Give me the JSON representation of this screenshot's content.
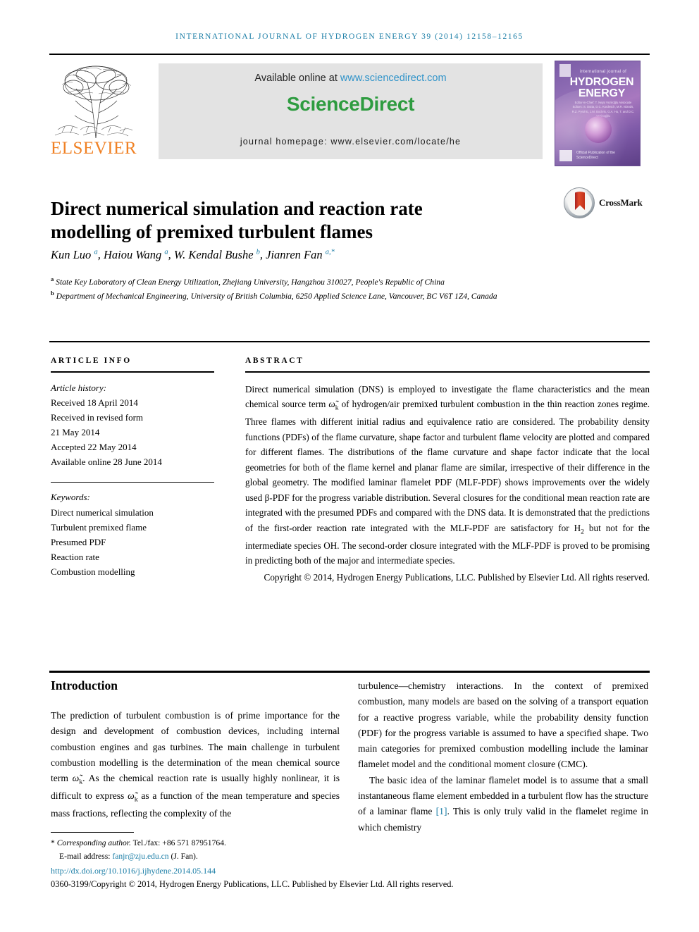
{
  "running_head": "INTERNATIONAL JOURNAL OF HYDROGEN ENERGY 39 (2014) 12158–12165",
  "masthead": {
    "publisher_name": "ELSEVIER",
    "available_prefix": "Available online at ",
    "available_url": "www.sciencedirect.com",
    "sciencedirect_logo": "ScienceDirect",
    "journal_homepage": "journal homepage: www.elsevier.com/locate/he",
    "cover": {
      "kicker": "international journal of",
      "title_line1": "HYDROGEN",
      "title_line2": "ENERGY",
      "editors": "Editor-in-Chief: T. Nejat Veziroğlu\nAssociate Editors: S. Dutta, D.C. Kordesch, M.R. Islands, R.Z. Pyrohic, J.M. Bockris, G.A. Hu, T. and D.C. Vezirogğlu",
      "bottom_note": "Official Publication of the\nScienceDirect"
    }
  },
  "article": {
    "title": "Direct numerical simulation and reaction rate modelling of premixed turbulent flames",
    "crossmark_label": "CrossMark",
    "authors_html": "Kun Luo <sup>a</sup>, Haiou Wang <sup>a</sup>, W. Kendal Bushe <sup>b</sup>, Jianren Fan <sup>a,*</sup>",
    "affiliations": [
      "State Key Laboratory of Clean Energy Utilization, Zhejiang University, Hangzhou 310027, People's Republic of China",
      "Department of Mechanical Engineering, University of British Columbia, 6250 Applied Science Lane, Vancouver, BC V6T 1Z4, Canada"
    ],
    "affiliation_marks": [
      "a",
      "b"
    ]
  },
  "article_info": {
    "heading": "ARTICLE INFO",
    "history_label": "Article history:",
    "history": [
      "Received 18 April 2014",
      "Received in revised form",
      "21 May 2014",
      "Accepted 22 May 2014",
      "Available online 28 June 2014"
    ],
    "keywords_label": "Keywords:",
    "keywords": [
      "Direct numerical simulation",
      "Turbulent premixed flame",
      "Presumed PDF",
      "Reaction rate",
      "Combustion modelling"
    ]
  },
  "abstract": {
    "heading": "ABSTRACT",
    "part1": "Direct numerical simulation (DNS) is employed to investigate the flame characteristics and the mean chemical source term ",
    "symbol": "ω̃",
    "symbol_sub": "k",
    "part2": " of hydrogen/air premixed turbulent combustion in the thin reaction zones regime. Three flames with different initial radius and equivalence ratio are considered. The probability density functions (PDFs) of the flame curvature, shape factor and turbulent flame velocity are plotted and compared for different flames. The distributions of the flame curvature and shape factor indicate that the local geometries for both of the flame kernel and planar flame are similar, irrespective of their difference in the global geometry. The modified laminar flamelet PDF (MLF-PDF) shows improvements over the widely used β-PDF for the progress variable distribution. Several closures for the conditional mean reaction rate are integrated with the presumed PDFs and compared with the DNS data. It is demonstrated that the predictions of the first-order reaction rate integrated with the MLF-PDF are satisfactory for H",
    "h2_sub": "2",
    "part3": " but not for the intermediate species OH. The second-order closure integrated with the MLF-PDF is proved to be promising in predicting both of the major and intermediate species.",
    "copyright": "Copyright © 2014, Hydrogen Energy Publications, LLC. Published by Elsevier Ltd. All rights reserved."
  },
  "body": {
    "intro_heading": "Introduction",
    "left_para_1a": "The prediction of turbulent combustion is of prime importance for the design and development of combustion devices, including internal combustion engines and gas turbines. The main challenge in turbulent combustion modelling is the determination of the mean chemical source term ",
    "left_para_1b": ". As the chemical reaction rate is usually highly nonlinear, it is difficult to express ",
    "left_para_1c": " as a function of the mean temperature and species mass fractions, reflecting the complexity of the",
    "right_para_1": "turbulence—chemistry interactions. In the context of premixed combustion, many models are based on the solving of a transport equation for a reactive progress variable, while the probability density function (PDF) for the progress variable is assumed to have a specified shape. Two main categories for premixed combustion modelling include the laminar flamelet model and the conditional moment closure (CMC).",
    "right_para_2a": "The basic idea of the laminar flamelet model is to assume that a small instantaneous flame element embedded in a turbulent flow has the structure of a laminar flame ",
    "right_citation": "[1]",
    "right_para_2b": ". This is only truly valid in the flamelet regime in which chemistry"
  },
  "footer": {
    "corresponding_label": "Corresponding author.",
    "tel": " Tel./fax: +86 571 87951764.",
    "email_label": "E-mail address: ",
    "email": "fanjr@zju.edu.cn",
    "email_suffix": " (J. Fan).",
    "doi": "http://dx.doi.org/10.1016/j.ijhydene.2014.05.144",
    "issn_copyright": "0360-3199/Copyright © 2014, Hydrogen Energy Publications, LLC. Published by Elsevier Ltd. All rights reserved."
  },
  "colors": {
    "link_blue": "#1a7da6",
    "elsevier_orange": "#f08124",
    "sciencedirect_green": "#2e9c40",
    "sd_url_blue": "#2f93c9"
  }
}
